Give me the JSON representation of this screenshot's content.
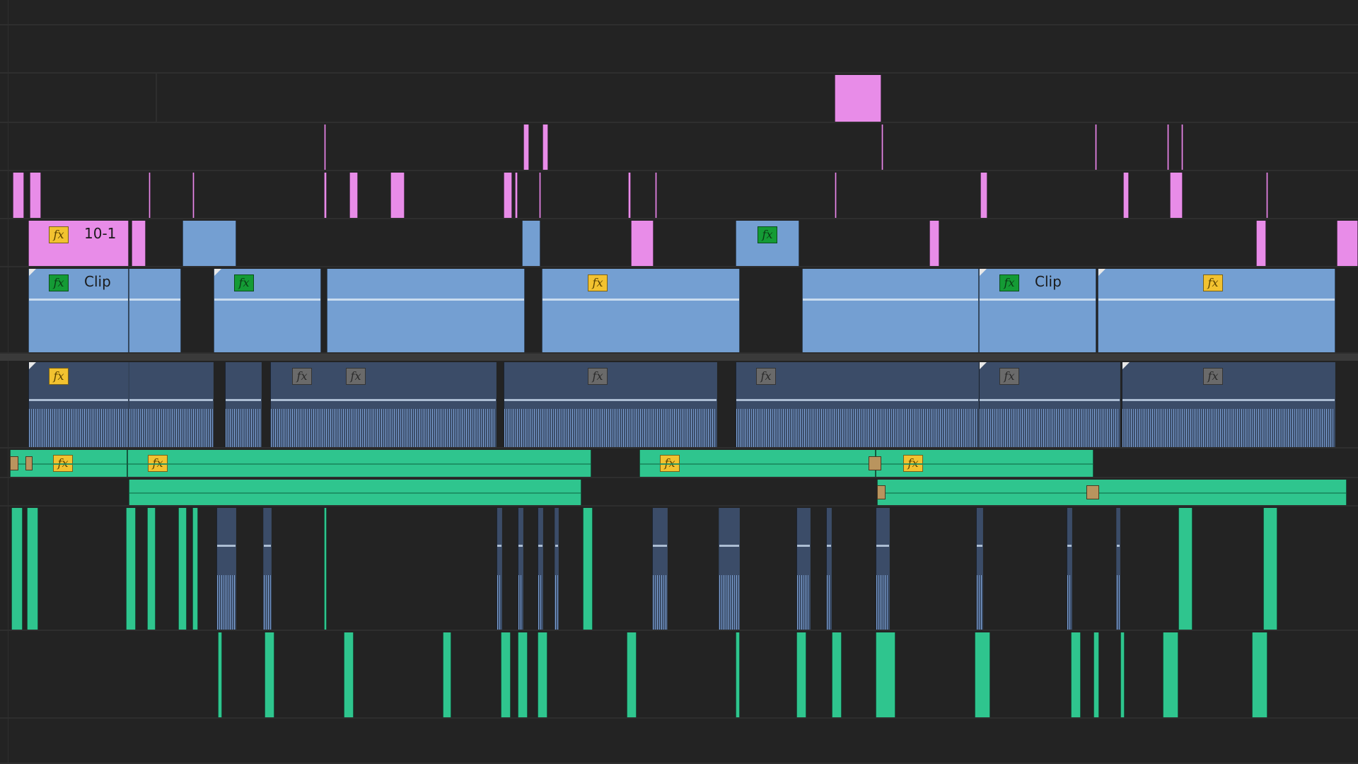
{
  "clip_labels": {
    "label_10_1": "10-1",
    "label_clip_a": "Clip",
    "label_clip_b": "Clip"
  },
  "fx_text": "fx",
  "colors": {
    "background": "#232323",
    "pink": "#e88ce8",
    "blue": "#749fd2",
    "green": "#2fc58e",
    "fx_yellow": "#f2c230",
    "fx_green": "#149b35",
    "fx_gray": "#6a6a6a"
  }
}
